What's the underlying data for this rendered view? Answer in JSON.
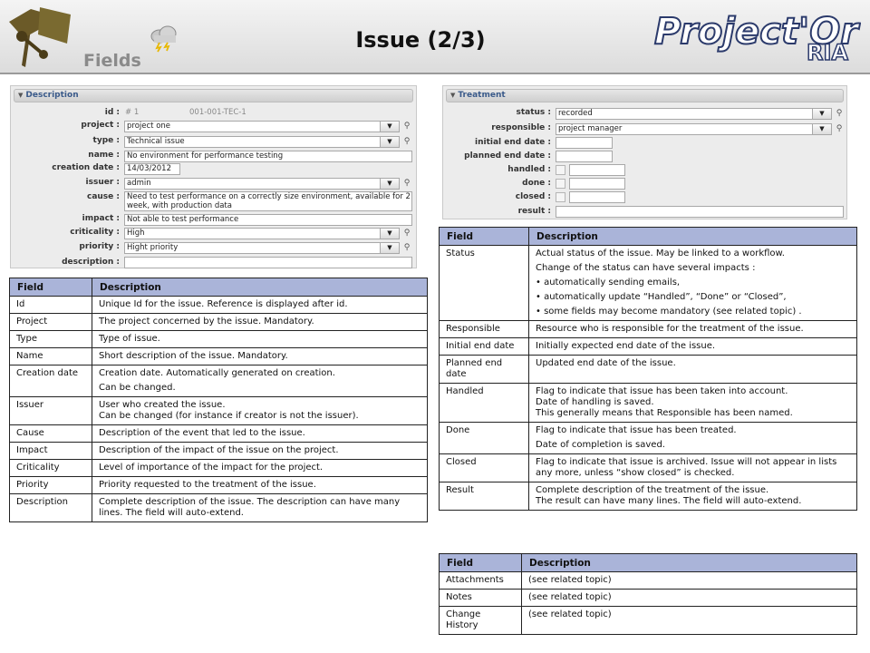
{
  "header": {
    "section_label": "Fields",
    "title": "Issue (2/3)",
    "brand": "Project'Or",
    "brand_suffix": "RIA"
  },
  "description_panel": {
    "title": "Description",
    "fields": {
      "id": {
        "label": "id :",
        "value": "# 1",
        "reference": "001-001-TEC-1"
      },
      "project": {
        "label": "project :",
        "value": "project one"
      },
      "type": {
        "label": "type :",
        "value": "Technical issue"
      },
      "name": {
        "label": "name :",
        "value": "No environment for performance testing"
      },
      "creation_date": {
        "label": "creation date :",
        "value": "14/03/2012"
      },
      "issuer": {
        "label": "issuer :",
        "value": "admin"
      },
      "cause": {
        "label": "cause :",
        "value": "Need to test performance on a correctly size environment, available for 2 week, with production data"
      },
      "impact": {
        "label": "impact :",
        "value": "Not able to test performance"
      },
      "criticality": {
        "label": "criticality :",
        "value": "High"
      },
      "priority": {
        "label": "priority :",
        "value": "Hight priority"
      },
      "description": {
        "label": "description :",
        "value": ""
      }
    }
  },
  "treatment_panel": {
    "title": "Treatment",
    "fields": {
      "status": {
        "label": "status :",
        "value": "recorded"
      },
      "responsible": {
        "label": "responsible :",
        "value": "project manager"
      },
      "initial_end_date": {
        "label": "initial end date :",
        "value": ""
      },
      "planned_end_date": {
        "label": "planned end date :",
        "value": ""
      },
      "handled": {
        "label": "handled :",
        "value": ""
      },
      "done": {
        "label": "done :",
        "value": ""
      },
      "closed": {
        "label": "closed :",
        "value": ""
      },
      "result": {
        "label": "result :",
        "value": ""
      }
    }
  },
  "left_table": {
    "headers": [
      "Field",
      "Description"
    ],
    "rows": [
      {
        "field": "Id",
        "desc": [
          "Unique Id for the issue. Reference is displayed after id."
        ]
      },
      {
        "field": "Project",
        "desc": [
          "The project concerned by the issue. Mandatory."
        ]
      },
      {
        "field": "Type",
        "desc": [
          "Type of issue."
        ]
      },
      {
        "field": "Name",
        "desc": [
          "Short description of the issue. Mandatory."
        ]
      },
      {
        "field": "Creation date",
        "desc": [
          "Creation date. Automatically generated on creation.",
          "Can be changed."
        ]
      },
      {
        "field": "Issuer",
        "desc": [
          "User who created the issue.",
          "Can be changed (for instance if creator is not the issuer)."
        ],
        "nolines": true
      },
      {
        "field": "Cause",
        "desc": [
          "Description of the event that led to the issue."
        ]
      },
      {
        "field": "Impact",
        "desc": [
          "Description of the impact of the issue on the project."
        ]
      },
      {
        "field": "Criticality",
        "desc": [
          "Level of importance of the impact for the project."
        ]
      },
      {
        "field": "Priority",
        "desc": [
          "Priority requested to the treatment of the issue."
        ]
      },
      {
        "field": "Description",
        "desc": [
          "Complete description of the issue. The description can have many lines. The field will auto-extend."
        ]
      }
    ]
  },
  "right_table": {
    "headers": [
      "Field",
      "Description"
    ],
    "rows": [
      {
        "field": "Status",
        "desc": [
          "Actual status of the issue. May be linked to a workflow.",
          "Change of the status can have several impacts :",
          "• automatically sending emails,",
          "• automatically update “Handled”, “Done” or “Closed”,",
          "• some fields may become mandatory (see related topic) ."
        ]
      },
      {
        "field": "Responsible",
        "desc": [
          "Resource who is responsible for the treatment of the issue."
        ]
      },
      {
        "field": "Initial end date",
        "desc": [
          "Initially expected end date of the issue."
        ]
      },
      {
        "field": "Planned end date",
        "desc": [
          "Updated end date of the issue."
        ]
      },
      {
        "field": "Handled",
        "desc": [
          "Flag to indicate that issue has been taken into account.",
          "Date of handling is saved.",
          "This generally means that Responsible has been named."
        ],
        "nolines": true
      },
      {
        "field": "Done",
        "desc": [
          "Flag to indicate that issue has been treated.",
          "Date of completion is saved."
        ]
      },
      {
        "field": "Closed",
        "desc": [
          "Flag to indicate that issue is archived. Issue will not appear in lists any more, unless “show closed” is checked."
        ]
      },
      {
        "field": "Result",
        "desc": [
          "Complete description of the treatment of the issue.",
          "The result can have many lines. The field will auto-extend."
        ],
        "nolines": true
      }
    ]
  },
  "bottom_table": {
    "headers": [
      "Field",
      "Description"
    ],
    "rows": [
      {
        "field": "Attachments",
        "desc": [
          "(see related topic)"
        ]
      },
      {
        "field": "Notes",
        "desc": [
          "(see related topic)"
        ]
      },
      {
        "field": "Change History",
        "desc": [
          "(see related topic)"
        ]
      }
    ]
  }
}
